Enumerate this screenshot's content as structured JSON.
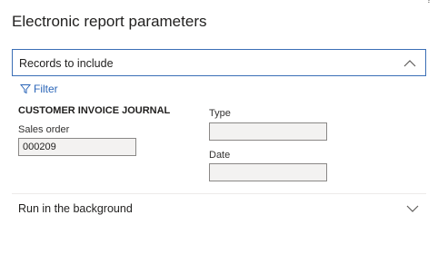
{
  "header": {
    "help_mark": "?",
    "title": "Electronic report parameters"
  },
  "records_section": {
    "label": "Records to include",
    "expanded": true,
    "filter_label": "Filter",
    "group_title": "CUSTOMER INVOICE JOURNAL",
    "fields": {
      "sales_order": {
        "label": "Sales order",
        "value": "000209"
      },
      "type": {
        "label": "Type",
        "value": ""
      },
      "date": {
        "label": "Date",
        "value": ""
      }
    }
  },
  "background_section": {
    "label": "Run in the background",
    "expanded": false
  },
  "colors": {
    "accent": "#2b66b8",
    "border_focus": "#3b6fb6",
    "input_bg": "#f3f2f1"
  },
  "icons": {
    "filter": "filter-icon",
    "collapse": "chevron-up-icon",
    "expand": "chevron-down-icon"
  }
}
